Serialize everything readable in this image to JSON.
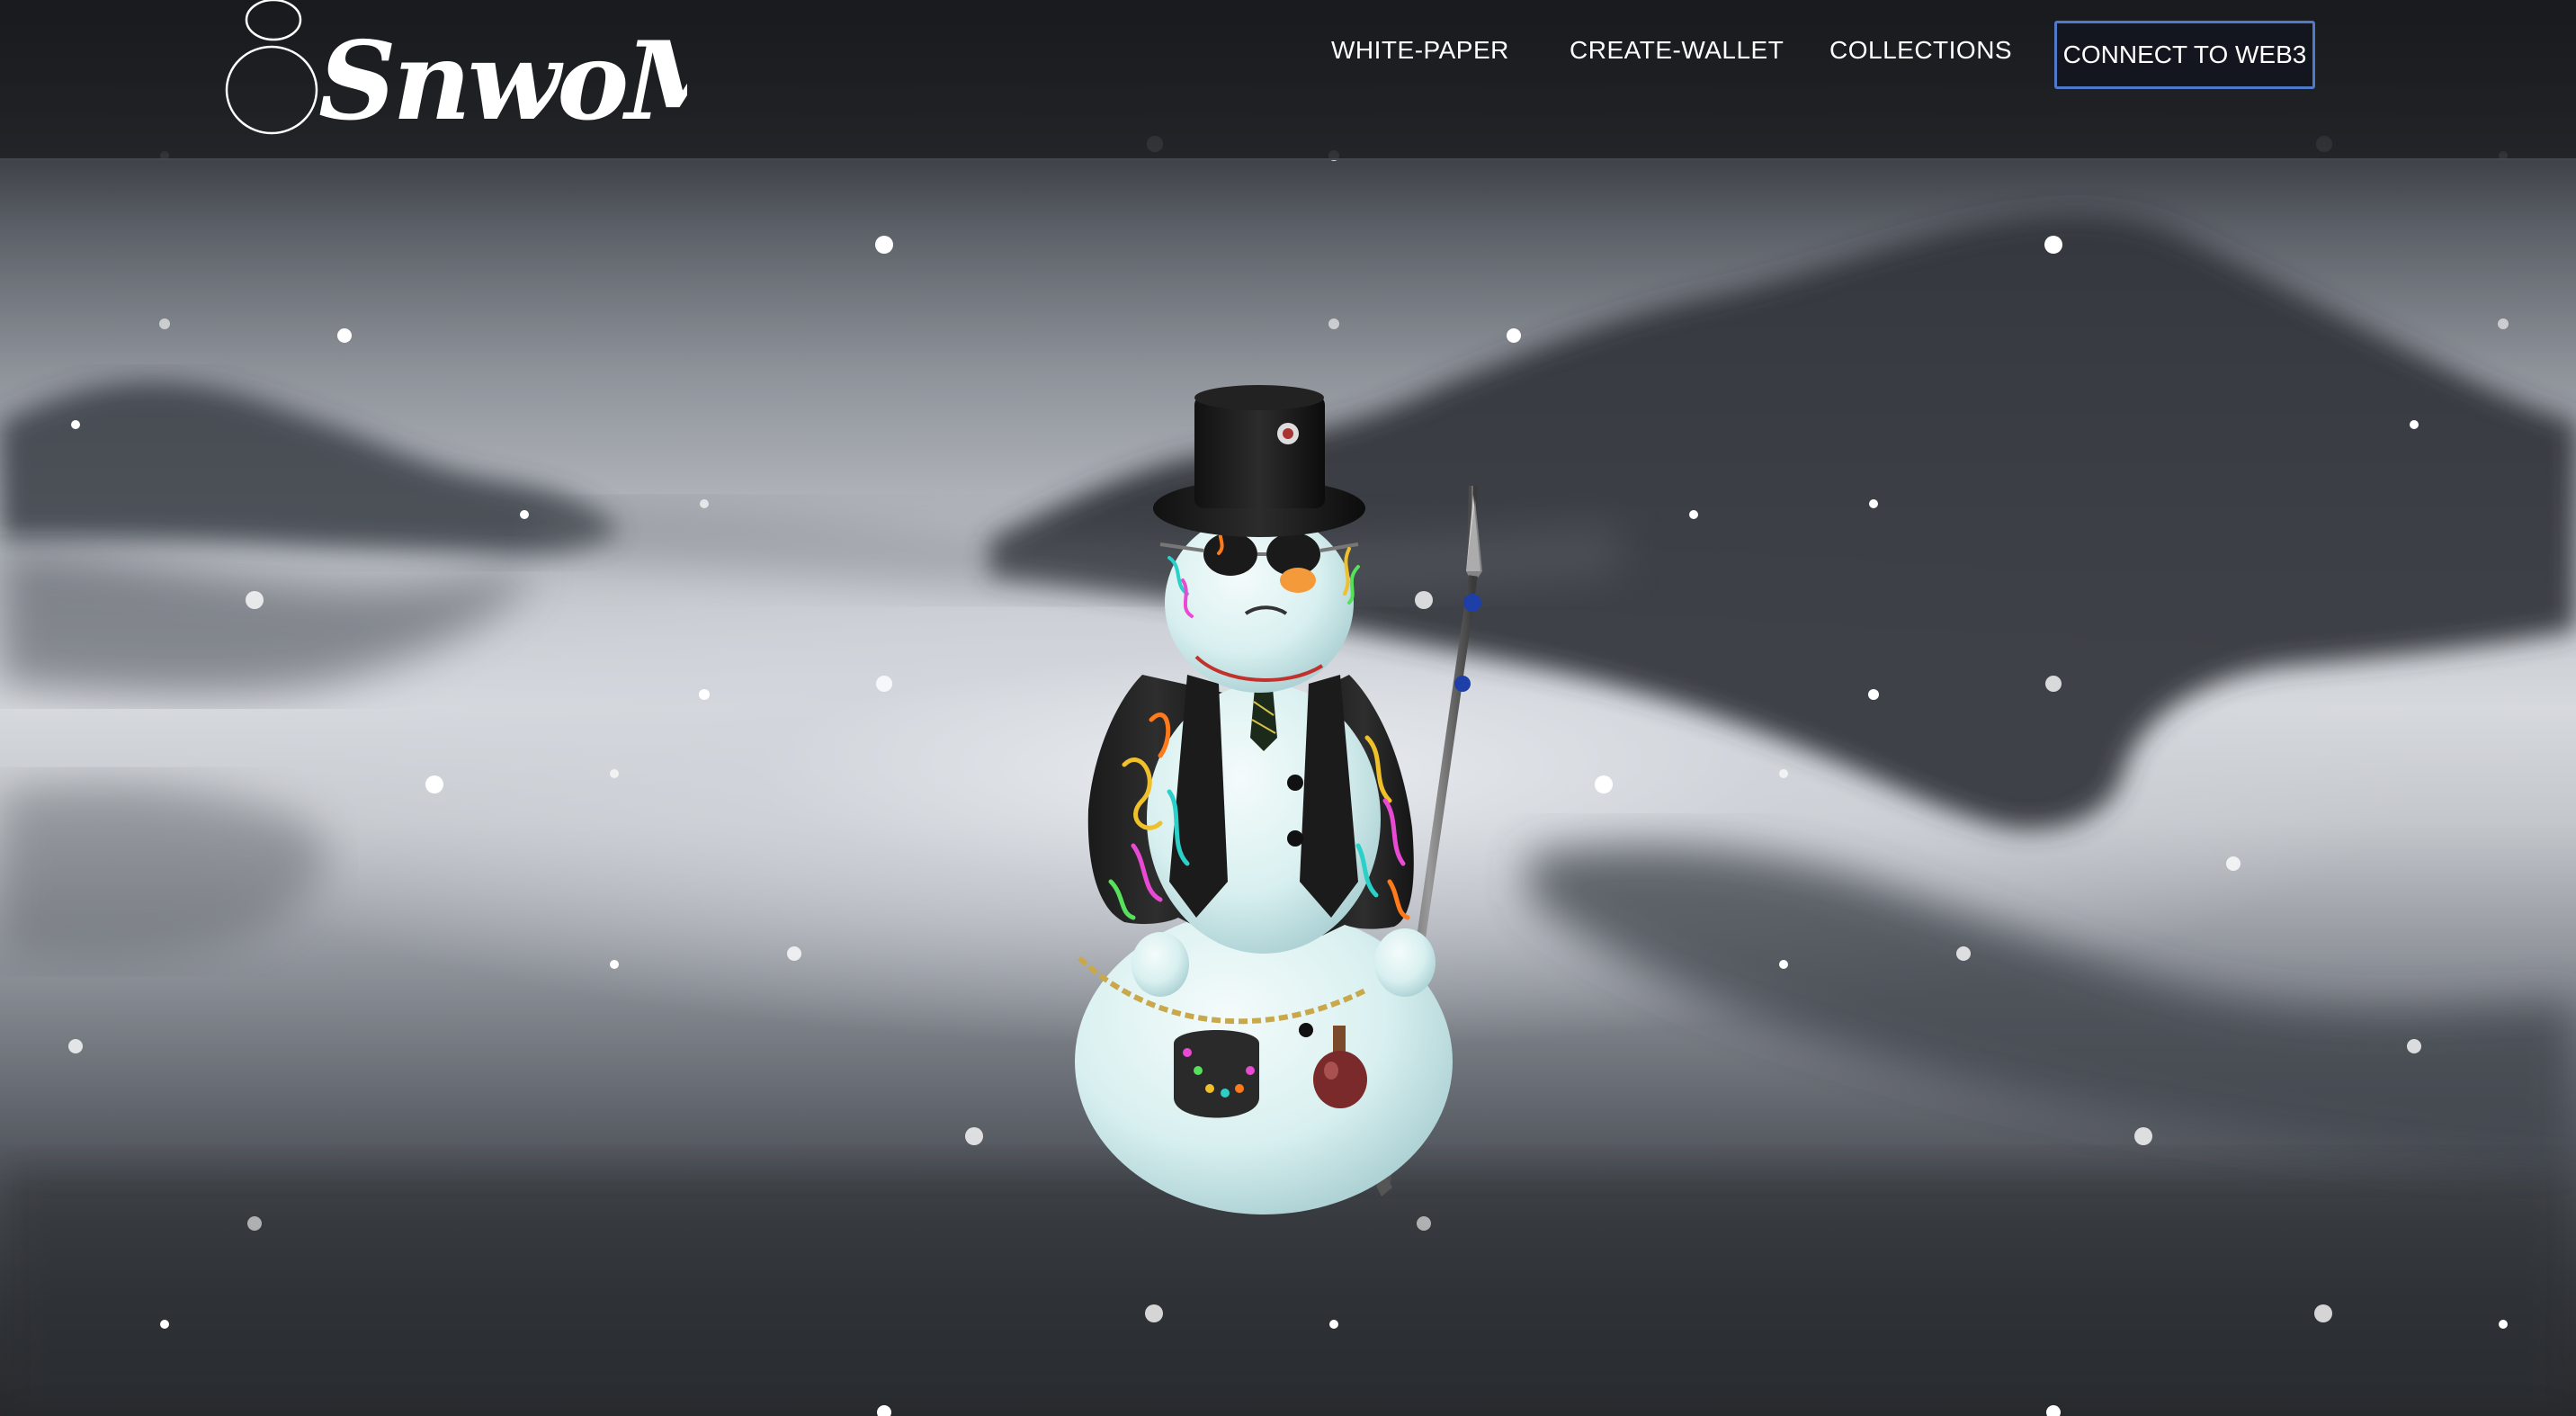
{
  "header": {
    "logo_text": "SnwoMan",
    "nav": [
      {
        "label": "WHITE-PAPER"
      },
      {
        "label": "CREATE-WALLET"
      },
      {
        "label": "COLLECTIONS"
      }
    ],
    "connect_label": "CONNECT TO WEB3"
  },
  "hero": {
    "image": "snowman-character-illustration",
    "background": "misty-mountain-lake-reflection"
  },
  "colors": {
    "button_border": "#4f79c9",
    "nav_text": "#ffffff"
  }
}
